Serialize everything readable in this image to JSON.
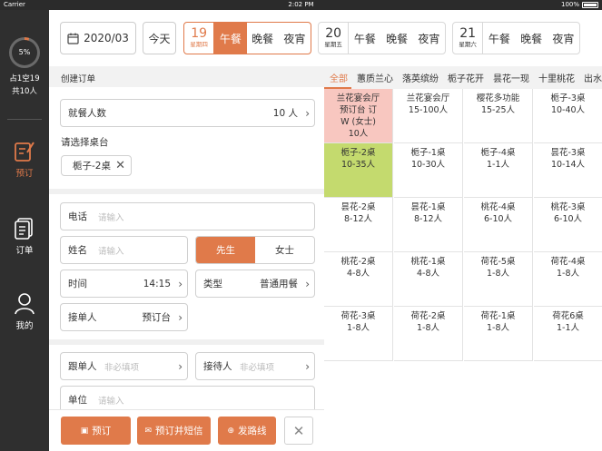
{
  "statusbar": {
    "carrier": "Carrier",
    "time": "2:02 PM",
    "battery": "100%"
  },
  "sidebar": {
    "occupancy_percent": "5%",
    "occupied_text": "占1空19",
    "people_text": "共10人",
    "nav": [
      {
        "label": "预订",
        "icon": "reserve-icon",
        "active": true
      },
      {
        "label": "订单",
        "icon": "orders-icon",
        "active": false
      },
      {
        "label": "我的",
        "icon": "profile-icon",
        "active": false
      }
    ]
  },
  "topbar": {
    "month": "2020/03",
    "today": "今天",
    "dates": [
      {
        "day": "19",
        "weekday": "星期四",
        "meals": [
          "午餐",
          "晚餐",
          "夜宵"
        ],
        "selected_meal": 0
      },
      {
        "day": "20",
        "weekday": "星期五",
        "meals": [
          "午餐",
          "晚餐",
          "夜宵"
        ]
      },
      {
        "day": "21",
        "weekday": "星期六",
        "meals": [
          "午餐",
          "晚餐",
          "夜宵"
        ]
      }
    ]
  },
  "form": {
    "section_title": "创建订单",
    "diners": {
      "label": "就餐人数",
      "value": "10 人"
    },
    "choose_table_label": "请选择桌台",
    "selected_table": "栀子-2桌",
    "phone": {
      "label": "电话",
      "placeholder": "请输入"
    },
    "name": {
      "label": "姓名",
      "placeholder": "请输入"
    },
    "gender": {
      "male": "先生",
      "female": "女士"
    },
    "time": {
      "label": "时间",
      "value": "14:15"
    },
    "type": {
      "label": "类型",
      "value": "普通用餐"
    },
    "receiver": {
      "label": "接单人",
      "value": "预订台"
    },
    "follower": {
      "label": "跟单人",
      "placeholder": "非必填项"
    },
    "host": {
      "label": "接待人",
      "placeholder": "非必填项"
    },
    "company": {
      "label": "单位",
      "placeholder": "请输入"
    }
  },
  "actions": {
    "reserve": "预订",
    "reserve_sms": "预订并短信",
    "send_route": "发路线"
  },
  "areas": [
    "全部",
    "蕙质兰心",
    "落英缤纷",
    "栀子花开",
    "昙花一现",
    "十里桃花",
    "出水芙蓉"
  ],
  "tables": [
    {
      "name": "兰花宴会厅",
      "extra": [
        "预订台 订",
        "W (女士)"
      ],
      "cap": "10人",
      "status": "reserved"
    },
    {
      "name": "兰花宴会厅",
      "cap": "15-100人",
      "status": "free"
    },
    {
      "name": "樱花多功能",
      "cap": "15-25人",
      "status": "free"
    },
    {
      "name": "栀子-3桌",
      "cap": "10-40人",
      "status": "free"
    },
    {
      "name": "栀子-2桌",
      "cap": "10-35人",
      "status": "selected"
    },
    {
      "name": "栀子-1桌",
      "cap": "10-30人",
      "status": "free"
    },
    {
      "name": "栀子-4桌",
      "cap": "1-1人",
      "status": "free"
    },
    {
      "name": "昙花-3桌",
      "cap": "10-14人",
      "status": "free"
    },
    {
      "name": "昙花-2桌",
      "cap": "8-12人",
      "status": "free"
    },
    {
      "name": "昙花-1桌",
      "cap": "8-12人",
      "status": "free"
    },
    {
      "name": "桃花-4桌",
      "cap": "6-10人",
      "status": "free"
    },
    {
      "name": "桃花-3桌",
      "cap": "6-10人",
      "status": "free"
    },
    {
      "name": "桃花-2桌",
      "cap": "4-8人",
      "status": "free"
    },
    {
      "name": "桃花-1桌",
      "cap": "4-8人",
      "status": "free"
    },
    {
      "name": "荷花-5桌",
      "cap": "1-8人",
      "status": "free"
    },
    {
      "name": "荷花-4桌",
      "cap": "1-8人",
      "status": "free"
    },
    {
      "name": "荷花-3桌",
      "cap": "1-8人",
      "status": "free"
    },
    {
      "name": "荷花-2桌",
      "cap": "1-8人",
      "status": "free"
    },
    {
      "name": "荷花-1桌",
      "cap": "1-8人",
      "status": "free"
    },
    {
      "name": "荷花6桌",
      "cap": "1-1人",
      "status": "free"
    }
  ],
  "colors": {
    "accent": "#e07a4a",
    "reserved": "#f8c7c0",
    "selected": "#c4da6e",
    "sidebar": "#2f2f2f"
  }
}
